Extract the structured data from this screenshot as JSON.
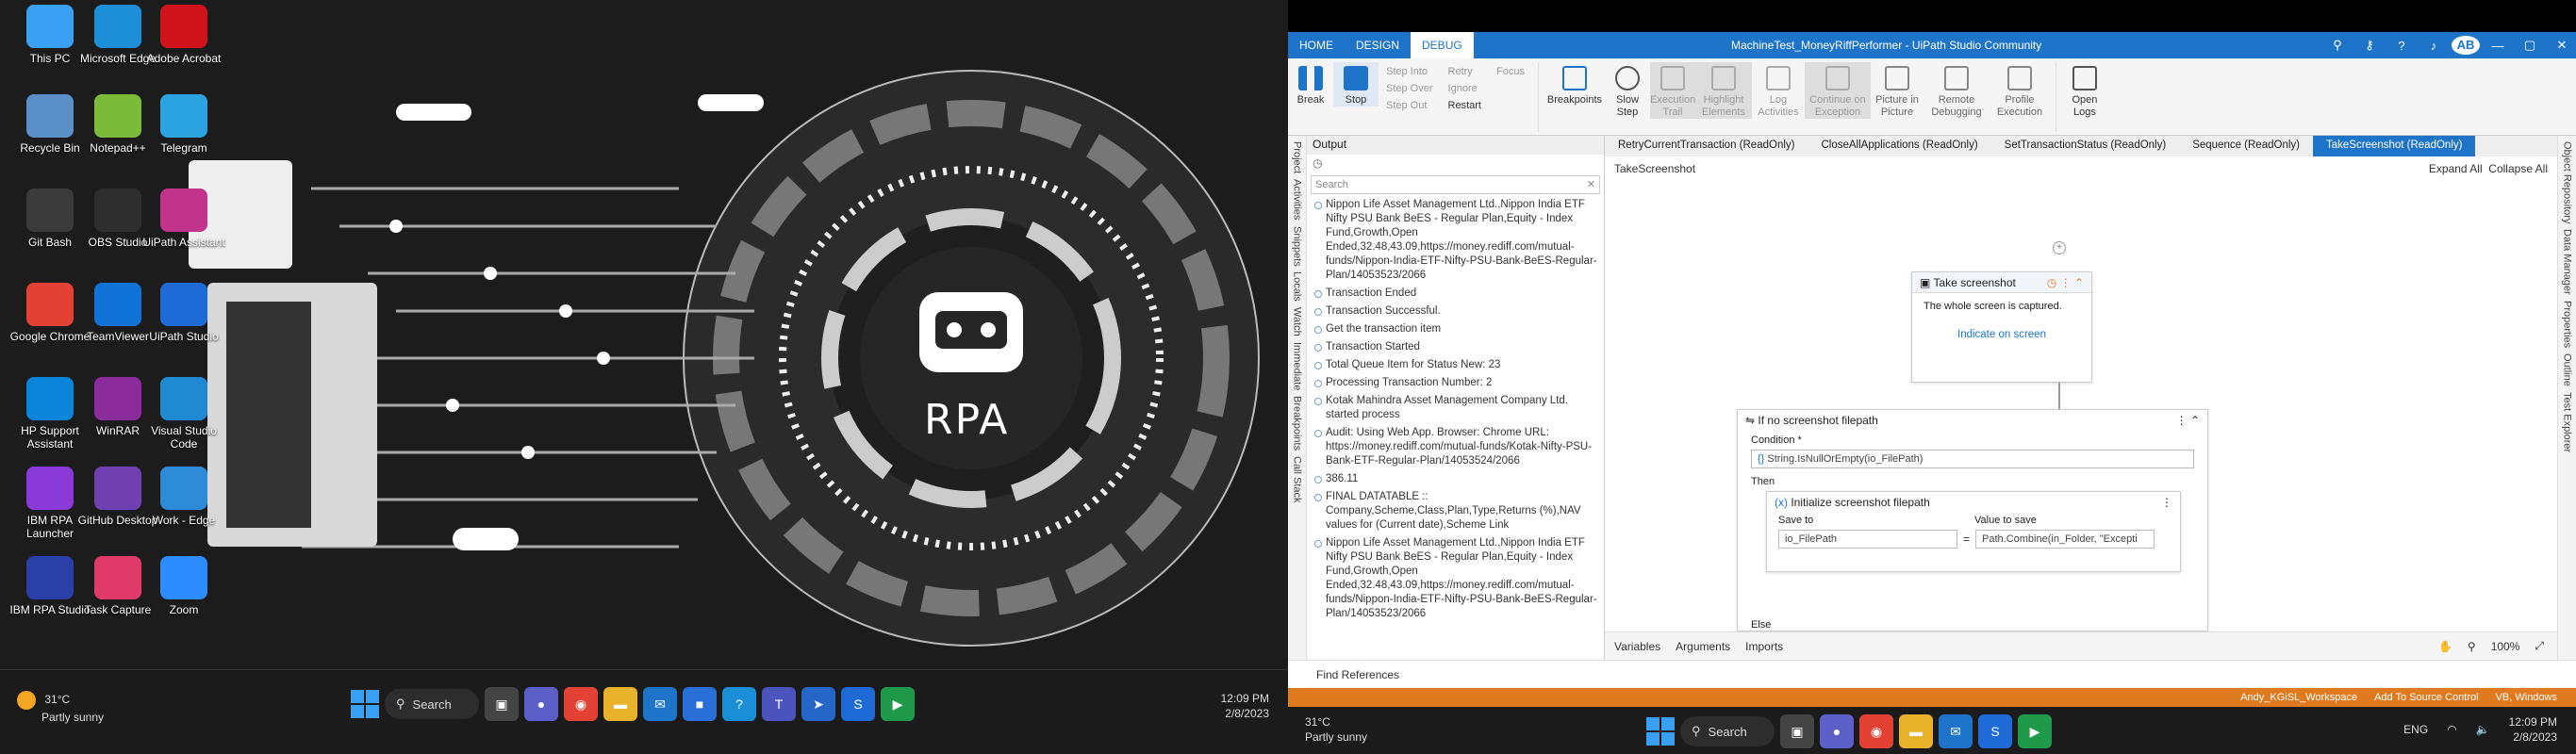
{
  "desktop": {
    "icons": [
      {
        "label": "This PC",
        "icon": "monitor-icon",
        "color": "#3aa0f3"
      },
      {
        "label": "Microsoft Edge",
        "icon": "edge-icon",
        "color": "#1c8fd6"
      },
      {
        "label": "Adobe Acrobat",
        "icon": "acrobat-icon",
        "color": "#d0121b"
      },
      {
        "label": "Recycle Bin",
        "icon": "recycle-bin-icon",
        "color": "#5a8fc8"
      },
      {
        "label": "Notepad++",
        "icon": "notepad-plus-icon",
        "color": "#7cba3a"
      },
      {
        "label": "Telegram",
        "icon": "telegram-icon",
        "color": "#2aa3e0"
      },
      {
        "label": "Git Bash",
        "icon": "git-bash-icon",
        "color": "#3b3b3b"
      },
      {
        "label": "OBS Studio",
        "icon": "obs-icon",
        "color": "#2e2e2e"
      },
      {
        "label": "UiPath Assistant",
        "icon": "uipath-assistant-icon",
        "color": "#c2338b"
      },
      {
        "label": "Google Chrome",
        "icon": "chrome-icon",
        "color": "#e24133"
      },
      {
        "label": "TeamViewer",
        "icon": "teamviewer-icon",
        "color": "#1173d8"
      },
      {
        "label": "UiPath Studio",
        "icon": "uipath-studio-icon",
        "color": "#1e6bd8"
      },
      {
        "label": "HP Support Assistant",
        "icon": "hp-icon",
        "color": "#0a84d8"
      },
      {
        "label": "WinRAR",
        "icon": "winrar-icon",
        "color": "#8b2a9a"
      },
      {
        "label": "Visual Studio Code",
        "icon": "vscode-icon",
        "color": "#1f8ad2"
      },
      {
        "label": "IBM RPA Launcher",
        "icon": "ibm-rpa-launcher-icon",
        "color": "#8a3ad8"
      },
      {
        "label": "GitHub Desktop",
        "icon": "github-icon",
        "color": "#7040b0"
      },
      {
        "label": "Work - Edge",
        "icon": "edge-work-icon",
        "color": "#2d8bd8"
      },
      {
        "label": "IBM RPA Studio",
        "icon": "ibm-rpa-studio-icon",
        "color": "#2a3fa8"
      },
      {
        "label": "Task Capture",
        "icon": "task-capture-icon",
        "color": "#e03a6a"
      },
      {
        "label": "Zoom",
        "icon": "zoom-icon",
        "color": "#2d8cff"
      }
    ],
    "wallpaper_text": "RPA"
  },
  "taskbar": {
    "temp": "31°C",
    "weather": "Partly sunny",
    "search_label": "Search",
    "time": "12:09 PM",
    "date": "2/8/2023",
    "lang": "ENG"
  },
  "studio": {
    "menu_tabs": [
      "HOME",
      "DESIGN",
      "DEBUG"
    ],
    "window_title": "MachineTest_MoneyRiffPerformer - UiPath Studio Community",
    "avatar_initials": "AB",
    "ribbon": {
      "break": "Break",
      "stop": "Stop",
      "step_into": "Step Into",
      "step_over": "Step Over",
      "step_out": "Step Out",
      "retry": "Retry",
      "ignore": "Ignore",
      "restart": "Restart",
      "focus": "Focus",
      "breakpoints": "Breakpoints",
      "slow_step": "Slow Step",
      "execution_trail": "Execution Trail",
      "highlight_elements": "Highlight Elements",
      "log_activities": "Log Activities",
      "continue_on_exception": "Continue on Exception",
      "picture_in_picture": "Picture in Picture",
      "remote_debugging": "Remote Debugging",
      "profile_execution": "Profile Execution",
      "open_logs": "Open Logs"
    },
    "left_rail": [
      "Project",
      "Activities",
      "Snippets",
      "Locals",
      "Watch",
      "Immediate",
      "Breakpoints",
      "Call Stack"
    ],
    "right_rail": [
      "Object Repository",
      "Data Manager",
      "Properties",
      "Outline",
      "Test Explorer"
    ],
    "output": {
      "title": "Output",
      "search_placeholder": "Search",
      "lines": [
        "Nippon Life Asset Management Ltd.,Nippon India ETF Nifty PSU Bank BeES - Regular Plan,Equity - Index Fund,Growth,Open Ended,32.48,43.09,https://money.rediff.com/mutual-funds/Nippon-India-ETF-Nifty-PSU-Bank-BeES-Regular-Plan/14053523/2066",
        "Transaction Ended",
        "Transaction Successful.",
        "Get the transaction item",
        "Transaction Started",
        "Total Queue Item for Status New: 23",
        "Processing Transaction Number: 2",
        "Kotak Mahindra Asset Management Company Ltd. started process",
        "Audit: Using Web App. Browser: Chrome URL: https://money.rediff.com/mutual-funds/Kotak-Nifty-PSU-Bank-ETF-Regular-Plan/14053524/2066",
        "386.11",
        "FINAL DATATABLE :: Company,Scheme,Class,Plan,Type,Returns (%),NAV values for (Current date),Scheme Link",
        "Nippon Life Asset Management Ltd.,Nippon India ETF Nifty PSU Bank BeES - Regular Plan,Equity - Index Fund,Growth,Open Ended,32.48,43.09,https://money.rediff.com/mutual-funds/Nippon-India-ETF-Nifty-PSU-Bank-BeES-Regular-Plan/14053523/2066"
      ]
    },
    "doc_tabs": [
      "RetryCurrentTransaction (ReadOnly)",
      "CloseAllApplications (ReadOnly)",
      "SetTransactionStatus (ReadOnly)",
      "Sequence (ReadOnly)",
      "TakeScreenshot (ReadOnly)"
    ],
    "breadcrumb": "TakeScreenshot",
    "expand_all": "Expand All",
    "collapse_all": "Collapse All",
    "take_screenshot": {
      "title": "Take screenshot",
      "desc": "The whole screen is captured.",
      "indicate": "Indicate on screen"
    },
    "if_block": {
      "title": "If no screenshot filepath",
      "condition_label": "Condition *",
      "condition": "String.IsNullOrEmpty(io_FilePath)",
      "then": "Then",
      "else": "Else"
    },
    "init": {
      "title": "Initialize screenshot filepath",
      "save_to_label": "Save to",
      "value_label": "Value to save",
      "save_to": "io_FilePath",
      "value": "Path.Combine(in_Folder, \"Excepti"
    },
    "bottom_tabs": [
      "Variables",
      "Arguments",
      "Imports"
    ],
    "zoom": "100%",
    "find_references": "Find References",
    "status": {
      "workspace": "Andy_KGiSL_Workspace",
      "source_control": "Add To Source Control",
      "env": "VB, Windows"
    }
  }
}
